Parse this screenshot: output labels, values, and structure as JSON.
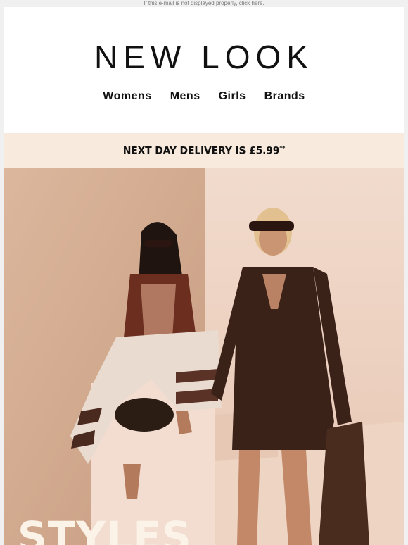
{
  "preheader": {
    "text": "If this e-mail is not displayed properly, click here."
  },
  "header": {
    "logo": "NEW LOOK"
  },
  "nav": {
    "items": [
      "Womens",
      "Mens",
      "Girls",
      "Brands"
    ]
  },
  "banner": {
    "text": "NEXT DAY DELIVERY IS £5.99",
    "footnote_mark": "**"
  },
  "hero": {
    "headline": "STYLES",
    "colors": {
      "wall": "#d9b398",
      "backdrop": "#efd6c6",
      "dress": "#3b2219",
      "accent": "#fbf2e8"
    }
  }
}
